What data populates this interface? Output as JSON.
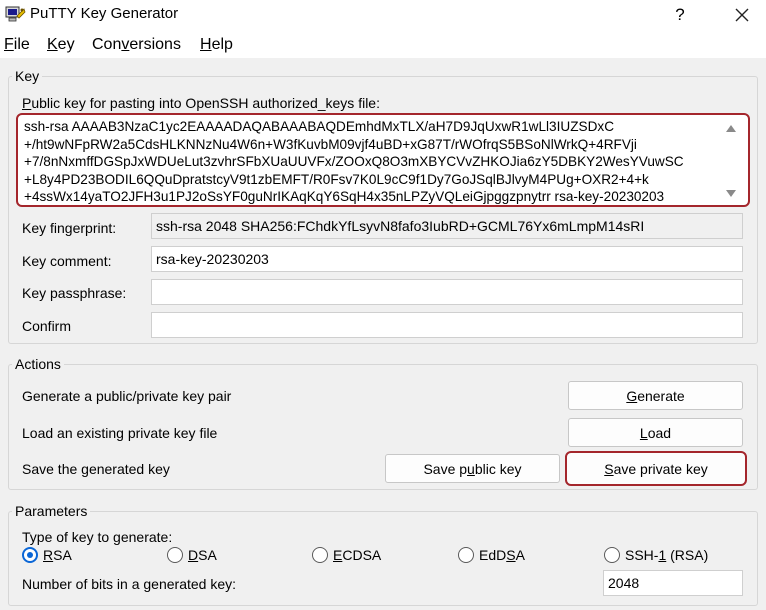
{
  "window": {
    "title": "PuTTY Key Generator",
    "help_glyph": "?",
    "close_glyph": "×"
  },
  "menu": [
    {
      "pre": "",
      "u": "F",
      "post": "ile"
    },
    {
      "pre": "",
      "u": "K",
      "post": "ey"
    },
    {
      "pre": "Con",
      "u": "v",
      "post": "ersions"
    },
    {
      "pre": "",
      "u": "H",
      "post": "elp"
    }
  ],
  "key_group": {
    "label": "Key",
    "public_key_label_u": "P",
    "public_key_label_rest": "ublic key for pasting into OpenSSH authorized_keys file:",
    "public_key_lines": [
      "ssh-rsa AAAAB3NzaC1yc2EAAAADAQABAAABAQDEmhdMxTLX/aH7D9JqUxwR1wLl3IUZSDxC",
      "+/ht9wNFpRW2a5CdsHLKNNzNu4W6n+W3fKuvbM09vjf4uBD+xG87T/rWOfrqS5BSoNlWrkQ+4RFVji",
      "+7/8nNxmffDGSpJxWDUeLut3zvhrSFbXUaUUVFx/ZOOxQ8O3mXBYCVvZHKOJia6zY5DBKY2WesYVuwSC",
      "+L8y4PD23BODIL6QQuDpratstcyV9t1zbEMFT/R0Fsv7K0L9cC9f1Dy7GoJSqlBJlvyM4PUg+OXR2+4+k",
      "+4ssWx14yaTO2JFH3u1PJ2oSsYF0guNrIKAqKqY6SqH4x35nLPZyVQLeiGjpggzpnytrr rsa-key-20230203"
    ],
    "fingerprint_label": "Key fingerprint:",
    "fingerprint_value": "ssh-rsa 2048 SHA256:FChdkYfLsyvN8fafo3IubRD+GCML76Yx6mLmpM14sRI",
    "comment_label": "Key comment:",
    "comment_value": "rsa-key-20230203",
    "passphrase_label": "Key passphrase:",
    "passphrase_value": "",
    "confirm_label": "Confirm",
    "confirm_value": ""
  },
  "actions": {
    "label": "Actions",
    "generate_desc": "Generate a public/private key pair",
    "load_desc": "Load an existing private key file",
    "save_desc": "Save the generated key",
    "generate_btn": {
      "pre": "",
      "u": "G",
      "post": "enerate"
    },
    "load_btn": {
      "pre": "",
      "u": "L",
      "post": "oad"
    },
    "save_public_btn": {
      "pre": "Save p",
      "u": "u",
      "post": "blic key"
    },
    "save_private_btn": {
      "pre": "",
      "u": "S",
      "post": "ave private key"
    }
  },
  "parameters": {
    "label": "Parameters",
    "type_label": "Type of key to generate:",
    "types": [
      {
        "pre": "",
        "u": "R",
        "post": "SA",
        "checked": true
      },
      {
        "pre": "",
        "u": "D",
        "post": "SA",
        "checked": false
      },
      {
        "pre": "",
        "u": "E",
        "post": "CDSA",
        "checked": false
      },
      {
        "pre": "EdD",
        "u": "S",
        "post": "A",
        "checked": false
      },
      {
        "pre": "SSH-",
        "u": "1",
        "post": " (RSA)",
        "checked": false
      }
    ],
    "bits_label": "Number of bits in a generated key:",
    "bits_value": "2048"
  }
}
